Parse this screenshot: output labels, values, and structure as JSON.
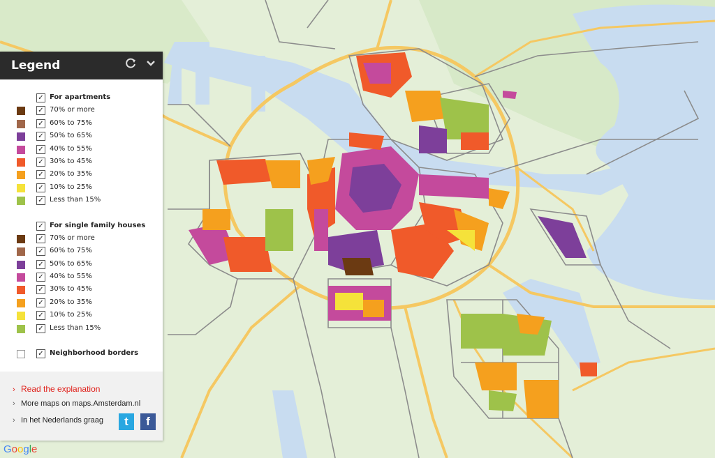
{
  "legend": {
    "title": "Legend",
    "groups": [
      {
        "title": "For apartments",
        "checked": true,
        "items": [
          {
            "label": "70% or more",
            "color": "#6b3a12"
          },
          {
            "label": "60% to 75%",
            "color": "#a0674a"
          },
          {
            "label": "50% to 65%",
            "color": "#7d3f9a"
          },
          {
            "label": "40% to 55%",
            "color": "#c44a9c"
          },
          {
            "label": "30% to 45%",
            "color": "#f05a2a"
          },
          {
            "label": "20% to 35%",
            "color": "#f5a01e"
          },
          {
            "label": "10% to 25%",
            "color": "#f5e23a"
          },
          {
            "label": "Less than 15%",
            "color": "#9ec24a"
          }
        ]
      },
      {
        "title": "For single family houses",
        "checked": true,
        "items": [
          {
            "label": "70% or more",
            "color": "#6b3a12"
          },
          {
            "label": "60% to 75%",
            "color": "#a0674a"
          },
          {
            "label": "50% to 65%",
            "color": "#7d3f9a"
          },
          {
            "label": "40% to 55%",
            "color": "#c44a9c"
          },
          {
            "label": "30% to 45%",
            "color": "#f05a2a"
          },
          {
            "label": "20% to 35%",
            "color": "#f5a01e"
          },
          {
            "label": "10% to 25%",
            "color": "#f5e23a"
          },
          {
            "label": "Less than 15%",
            "color": "#9ec24a"
          }
        ]
      }
    ],
    "borders": {
      "label": "Neighborhood borders",
      "checked": true
    }
  },
  "links": {
    "explanation": "Read the explanation",
    "more_maps": "More maps on maps.Amsterdam.nl",
    "dutch": "In het Nederlands graag"
  },
  "social": {
    "twitter": "t",
    "facebook": "f"
  },
  "icons": {
    "refresh": "refresh-icon",
    "collapse": "chevron-down-icon"
  },
  "colors": {
    "twitter": "#29a7e1",
    "facebook": "#3b5998",
    "water": "#c8dcf0",
    "land": "#e4efd8",
    "road": "#f5c862"
  },
  "branding": {
    "google": "Google"
  }
}
